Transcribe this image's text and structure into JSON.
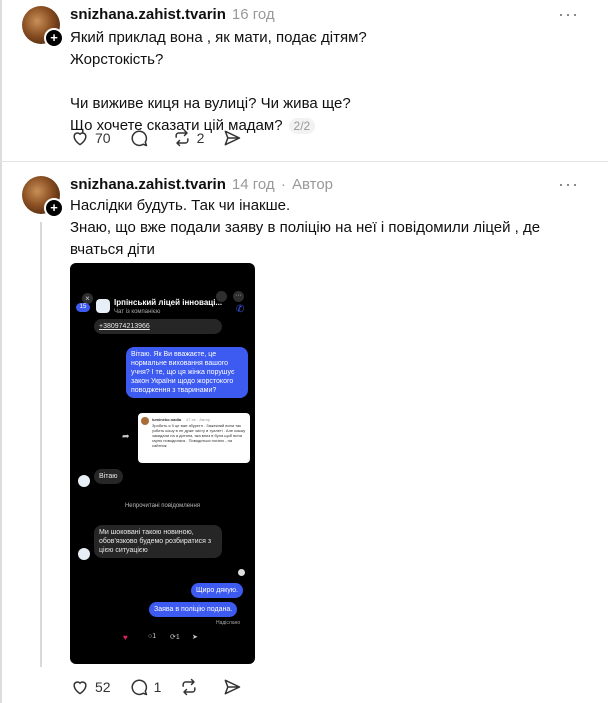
{
  "posts": [
    {
      "username": "snizhana.zahist.tvarin",
      "time": "16 год",
      "lines": [
        "Який приклад вона , як мати, подає дітям?",
        "Жорстокість?",
        "",
        "Чи виживе киця на вулиці? Чи жива ще?",
        "Що хочете сказати цій мадам?"
      ],
      "page": "2/2",
      "likes": "70",
      "reposts": "2"
    },
    {
      "username": "snizhana.zahist.tvarin",
      "time": "14 год",
      "author_sep": "·",
      "author": "Автор",
      "lines": [
        "Наслідки будуть. Так чи інакше.",
        "Знаю, що вже подали заяву в поліцію на неї і повідомили ліцей , де",
        "вчаться діти"
      ],
      "likes": "52",
      "comments": "1"
    }
  ],
  "more_glyph": "···",
  "screenshot": {
    "chat_title": "Ірпінський ліцей інноваці...",
    "chat_subtitle": "Чат із компанією",
    "phone": "+380974213966",
    "msg1": "Вітаю. Як Ви вважаєте, це нормальне виховання вашого учня? І те, що ця жінка порушує закон України щодо жорстокого поводження з тваринами?",
    "quoted_user": "lumineko.nadia",
    "quoted_meta": "47 хв · Автор",
    "quoted_text": "Зробить я її це вже збурєтн . Зажекний вона так узбить кошу в не дуже чисту в туалеті . Але кошку закидали на а дитина, яка вниз в була щоб вона гарно поводилася . Поводиться погано - на сайтник",
    "reply1": "Вітаю",
    "unread": "Непрочитані повідомлення",
    "reply2": "Ми шоковані такою новиною, обов'язково будемо розбиратися з цією ситуацією",
    "msg2": "Щиро дякую.",
    "msg3": "Заява в поліцію подана.",
    "sent": "Надіслано",
    "badge": "15"
  }
}
